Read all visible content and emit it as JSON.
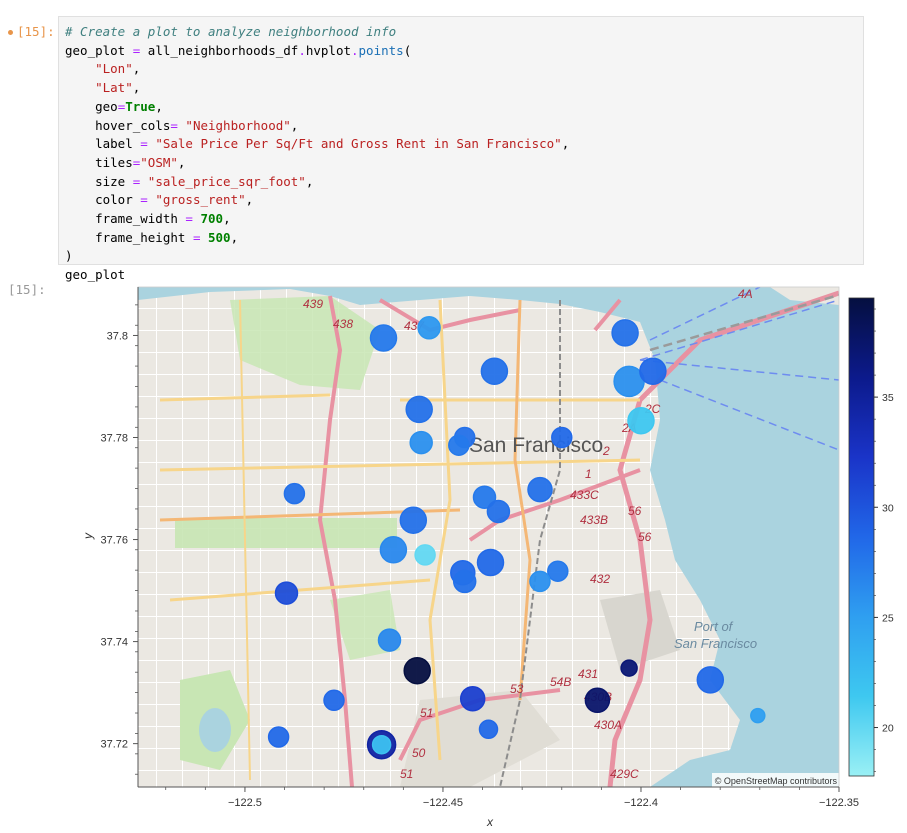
{
  "cell": {
    "input_prompt": "[15]:",
    "output_prompt": "[15]:",
    "code_lines": [
      [
        {
          "t": "cm",
          "v": "# Create a plot to analyze neighborhood info"
        }
      ],
      [
        {
          "t": "",
          "v": "geo_plot "
        },
        {
          "t": "op",
          "v": "="
        },
        {
          "t": "",
          "v": " all_neighborhoods_df"
        },
        {
          "t": "op",
          "v": "."
        },
        {
          "t": "",
          "v": "hvplot"
        },
        {
          "t": "op",
          "v": "."
        },
        {
          "t": "at",
          "v": "points"
        },
        {
          "t": "",
          "v": "("
        }
      ],
      [
        {
          "t": "",
          "v": "    "
        },
        {
          "t": "s",
          "v": "\"Lon\""
        },
        {
          "t": "",
          "v": ","
        }
      ],
      [
        {
          "t": "",
          "v": "    "
        },
        {
          "t": "s",
          "v": "\"Lat\""
        },
        {
          "t": "",
          "v": ","
        }
      ],
      [
        {
          "t": "",
          "v": "    geo"
        },
        {
          "t": "op",
          "v": "="
        },
        {
          "t": "kw",
          "v": "True"
        },
        {
          "t": "",
          "v": ","
        }
      ],
      [
        {
          "t": "",
          "v": "    hover_cols"
        },
        {
          "t": "op",
          "v": "="
        },
        {
          "t": "",
          "v": " "
        },
        {
          "t": "s",
          "v": "\"Neighborhood\""
        },
        {
          "t": "",
          "v": ","
        }
      ],
      [
        {
          "t": "",
          "v": "    label "
        },
        {
          "t": "op",
          "v": "="
        },
        {
          "t": "",
          "v": " "
        },
        {
          "t": "s",
          "v": "\"Sale Price Per Sq/Ft and Gross Rent in San Francisco\""
        },
        {
          "t": "",
          "v": ","
        }
      ],
      [
        {
          "t": "",
          "v": "    tiles"
        },
        {
          "t": "op",
          "v": "="
        },
        {
          "t": "s",
          "v": "\"OSM\""
        },
        {
          "t": "",
          "v": ","
        }
      ],
      [
        {
          "t": "",
          "v": "    size "
        },
        {
          "t": "op",
          "v": "="
        },
        {
          "t": "",
          "v": " "
        },
        {
          "t": "s",
          "v": "\"sale_price_sqr_foot\""
        },
        {
          "t": "",
          "v": ","
        }
      ],
      [
        {
          "t": "",
          "v": "    color "
        },
        {
          "t": "op",
          "v": "="
        },
        {
          "t": "",
          "v": " "
        },
        {
          "t": "s",
          "v": "\"gross_rent\""
        },
        {
          "t": "",
          "v": ","
        }
      ],
      [
        {
          "t": "",
          "v": "    frame_width "
        },
        {
          "t": "op",
          "v": "="
        },
        {
          "t": "",
          "v": " "
        },
        {
          "t": "nm",
          "v": "700"
        },
        {
          "t": "",
          "v": ","
        }
      ],
      [
        {
          "t": "",
          "v": "    frame_height "
        },
        {
          "t": "op",
          "v": "="
        },
        {
          "t": "",
          "v": " "
        },
        {
          "t": "nm",
          "v": "500"
        },
        {
          "t": "",
          "v": ","
        }
      ],
      [
        {
          "t": "",
          "v": ")"
        }
      ],
      [
        {
          "t": "",
          "v": "geo_plot"
        }
      ]
    ]
  },
  "map": {
    "city_label": "San Francisco",
    "port_label_1": "Port of",
    "port_label_2": "San Francisco",
    "attribution": "© OpenStreetMap contributors",
    "route_labels": [
      "439",
      "438",
      "437",
      "4A",
      "2C",
      "2A",
      "2",
      "1",
      "433C",
      "433B",
      "56",
      "56",
      "432",
      "431",
      "430B",
      "430A",
      "429C",
      "54B",
      "53",
      "51",
      "50",
      "51"
    ]
  },
  "chart_data": {
    "type": "scatter",
    "xlabel": "x",
    "ylabel": "y",
    "xlim": [
      -122.527,
      -122.35
    ],
    "ylim": [
      37.7115,
      37.8095
    ],
    "xticks": [
      -122.5,
      -122.45,
      -122.4,
      -122.35
    ],
    "xtick_labels": [
      "−122.5",
      "−122.45",
      "−122.4",
      "−122.35"
    ],
    "yticks": [
      37.72,
      37.74,
      37.76,
      37.78,
      37.8
    ],
    "ytick_labels": [
      "37.72",
      "37.74",
      "37.76",
      "37.78",
      "37.8"
    ],
    "colorbar": {
      "range": [
        17.8,
        39.5
      ],
      "ticks": [
        20,
        25,
        30,
        35
      ],
      "tick_labels": [
        "20",
        "25",
        "30",
        "35"
      ],
      "colors": [
        "#9af0f5",
        "#3ec8f0",
        "#2f9ff0",
        "#2167e8",
        "#1a34c8",
        "#0c1a8c",
        "#050f40"
      ]
    },
    "points": [
      {
        "lon": -122.465,
        "lat": 37.7995,
        "size": 13,
        "rent": 27.5
      },
      {
        "lon": -122.4535,
        "lat": 37.8015,
        "size": 11,
        "rent": 25.5
      },
      {
        "lon": -122.437,
        "lat": 37.793,
        "size": 13,
        "rent": 28.0
      },
      {
        "lon": -122.404,
        "lat": 37.8005,
        "size": 13,
        "rent": 28.0
      },
      {
        "lon": -122.403,
        "lat": 37.791,
        "size": 15,
        "rent": 26.0
      },
      {
        "lon": -122.397,
        "lat": 37.793,
        "size": 13,
        "rent": 28.5
      },
      {
        "lon": -122.456,
        "lat": 37.7855,
        "size": 13,
        "rent": 28.0
      },
      {
        "lon": -122.4,
        "lat": 37.7833,
        "size": 13,
        "rent": 21.5
      },
      {
        "lon": -122.4445,
        "lat": 37.78,
        "size": 10,
        "rent": 28.0
      },
      {
        "lon": -122.4555,
        "lat": 37.779,
        "size": 11,
        "rent": 26.0
      },
      {
        "lon": -122.446,
        "lat": 37.7785,
        "size": 10,
        "rent": 27.5
      },
      {
        "lon": -122.42,
        "lat": 37.78,
        "size": 10,
        "rent": 28.5
      },
      {
        "lon": -122.4875,
        "lat": 37.769,
        "size": 10,
        "rent": 28.0
      },
      {
        "lon": -122.4395,
        "lat": 37.7683,
        "size": 11,
        "rent": 27.5
      },
      {
        "lon": -122.4255,
        "lat": 37.7698,
        "size": 12,
        "rent": 28.0
      },
      {
        "lon": -122.436,
        "lat": 37.7655,
        "size": 11,
        "rent": 28.0
      },
      {
        "lon": -122.4575,
        "lat": 37.7638,
        "size": 13,
        "rent": 28.0
      },
      {
        "lon": -122.4625,
        "lat": 37.758,
        "size": 13,
        "rent": 26.5
      },
      {
        "lon": -122.4545,
        "lat": 37.757,
        "size": 10,
        "rent": 20.0
      },
      {
        "lon": -122.438,
        "lat": 37.7555,
        "size": 13,
        "rent": 28.5
      },
      {
        "lon": -122.445,
        "lat": 37.7535,
        "size": 12,
        "rent": 28.5
      },
      {
        "lon": -122.4445,
        "lat": 37.7518,
        "size": 11,
        "rent": 28.0
      },
      {
        "lon": -122.421,
        "lat": 37.7538,
        "size": 10,
        "rent": 27.5
      },
      {
        "lon": -122.4255,
        "lat": 37.7518,
        "size": 10,
        "rent": 26.0
      },
      {
        "lon": -122.4895,
        "lat": 37.7495,
        "size": 11,
        "rent": 30.5
      },
      {
        "lon": -122.4635,
        "lat": 37.7403,
        "size": 11,
        "rent": 26.5
      },
      {
        "lon": -122.4565,
        "lat": 37.7343,
        "size": 13,
        "rent": 39.5
      },
      {
        "lon": -122.403,
        "lat": 37.7348,
        "size": 8,
        "rent": 37.0
      },
      {
        "lon": -122.411,
        "lat": 37.7285,
        "size": 12,
        "rent": 37.5
      },
      {
        "lon": -122.4425,
        "lat": 37.7288,
        "size": 12,
        "rent": 31.5
      },
      {
        "lon": -122.3825,
        "lat": 37.7325,
        "size": 13,
        "rent": 28.5
      },
      {
        "lon": -122.4775,
        "lat": 37.7285,
        "size": 10,
        "rent": 28.5
      },
      {
        "lon": -122.4385,
        "lat": 37.7228,
        "size": 9,
        "rent": 28.5
      },
      {
        "lon": -122.4655,
        "lat": 37.7198,
        "size": 14,
        "rent": 34.5
      },
      {
        "lon": -122.4655,
        "lat": 37.7198,
        "size": 9,
        "rent": 22.0
      },
      {
        "lon": -122.4915,
        "lat": 37.7213,
        "size": 10,
        "rent": 28.5
      },
      {
        "lon": -122.3705,
        "lat": 37.7255,
        "size": 7,
        "rent": 25.0
      }
    ]
  }
}
